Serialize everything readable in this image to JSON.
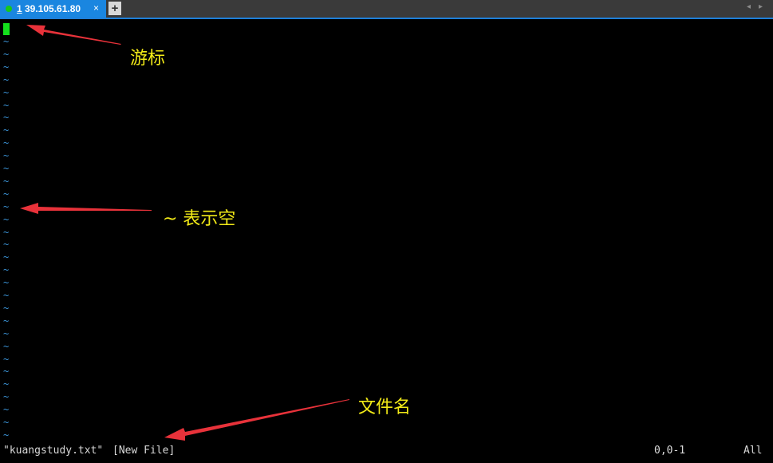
{
  "tab": {
    "number": "1",
    "title": "39.105.61.80",
    "close_glyph": "×"
  },
  "new_tab_glyph": "+",
  "nav": {
    "prev_glyph": "◂",
    "next_glyph": "▸"
  },
  "terminal": {
    "empty_line_marker": "~",
    "status": {
      "filename": "\"kuangstudy.txt\"",
      "flag": "[New File]",
      "position": "0,0-1",
      "scroll": "All"
    }
  },
  "annotations": {
    "cursor_label": "游标",
    "tilde_label": "~ 表示空",
    "filename_label": "文件名"
  },
  "colors": {
    "cursor": "#14e01c",
    "tilde": "#3c95d8",
    "annotation_text": "#f2ea17",
    "arrow": "#e8323a",
    "tab_active": "#1a86e0"
  }
}
